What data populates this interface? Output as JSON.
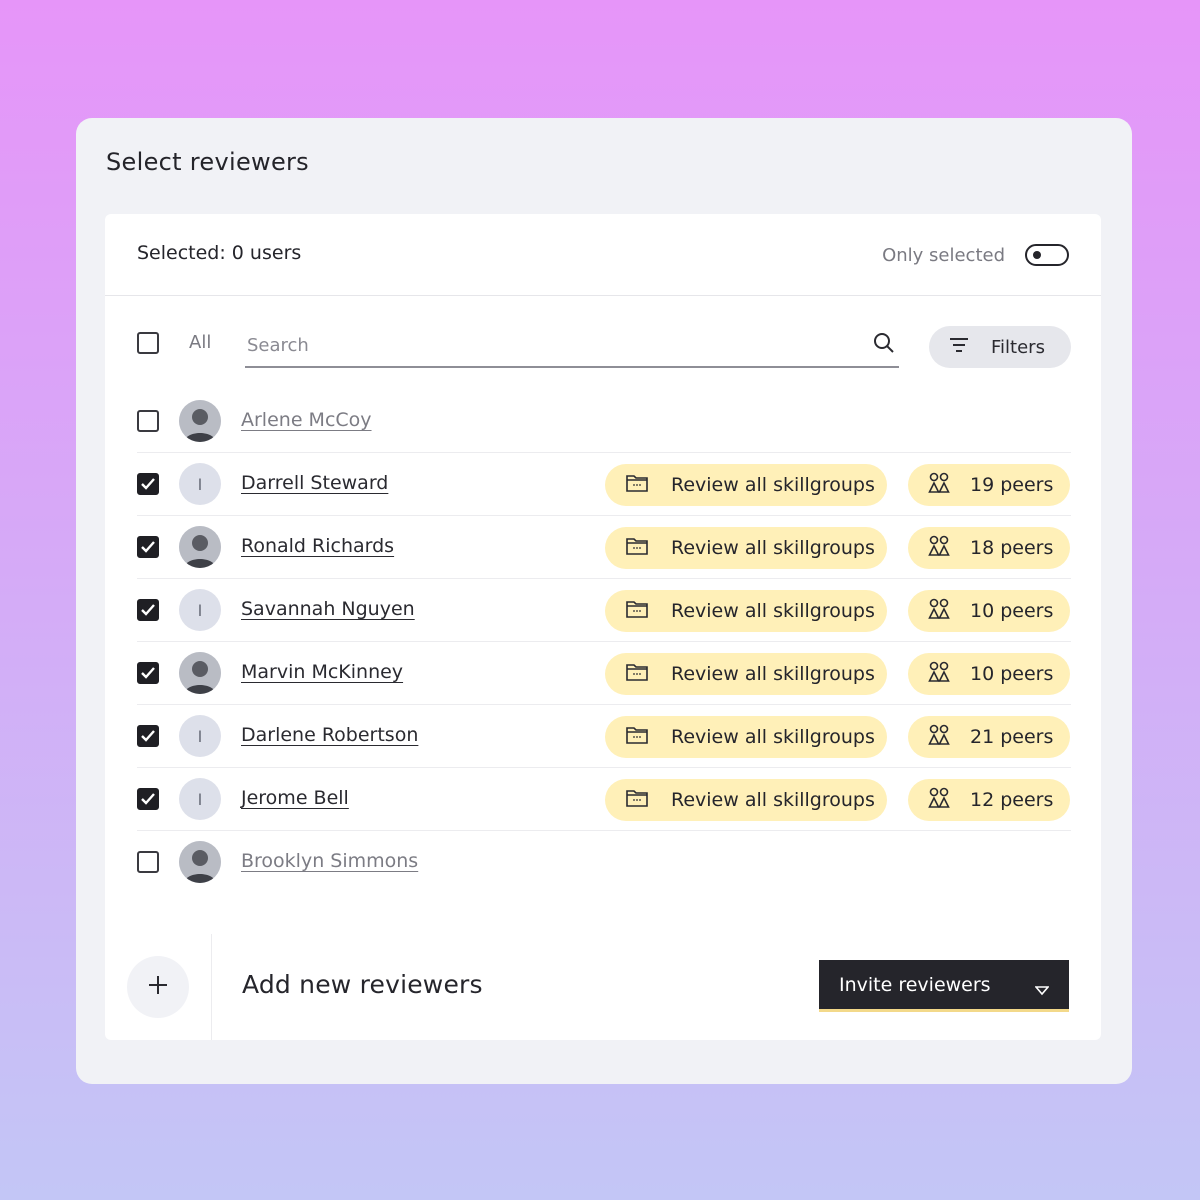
{
  "title": "Select reviewers",
  "header": {
    "selected_label": "Selected: 0 users",
    "only_selected_label": "Only selected",
    "only_selected_on": false
  },
  "toolbar": {
    "all_label": "All",
    "search_placeholder": "Search",
    "search_value": "",
    "filters_label": "Filters"
  },
  "reviewers": [
    {
      "name": "Arlene McCoy",
      "checked": false,
      "avatar": "photo",
      "skill": "",
      "peers": ""
    },
    {
      "name": "Darrell Steward",
      "checked": true,
      "avatar": "initial",
      "initial": "I",
      "skill": "Review all skillgroups",
      "peers": "19 peers"
    },
    {
      "name": "Ronald Richards",
      "checked": true,
      "avatar": "photo",
      "skill": "Review all skillgroups",
      "peers": "18 peers"
    },
    {
      "name": "Savannah Nguyen",
      "checked": true,
      "avatar": "initial",
      "initial": "I",
      "skill": "Review all skillgroups",
      "peers": "10 peers"
    },
    {
      "name": "Marvin McKinney",
      "checked": true,
      "avatar": "photo",
      "skill": "Review all skillgroups",
      "peers": "10 peers"
    },
    {
      "name": "Darlene Robertson",
      "checked": true,
      "avatar": "initial",
      "initial": "I",
      "skill": "Review all skillgroups",
      "peers": "21 peers"
    },
    {
      "name": "Jerome Bell",
      "checked": true,
      "avatar": "initial",
      "initial": "I",
      "skill": "Review all skillgroups",
      "peers": "12 peers"
    },
    {
      "name": "Brooklyn Simmons",
      "checked": false,
      "avatar": "photo",
      "skill": "",
      "peers": ""
    }
  ],
  "footer": {
    "add_label": "Add new reviewers",
    "invite_label": "Invite reviewers"
  },
  "icons": {
    "skill": "folder-icon",
    "peers": "peers-icon",
    "search": "search-icon",
    "filters": "filter-icon",
    "add": "plus-icon",
    "dropdown": "chevron-down-icon"
  },
  "colors": {
    "pill_bg": "#fff0b8",
    "primary_button": "#25252b",
    "card_bg": "#f1f2f6"
  }
}
